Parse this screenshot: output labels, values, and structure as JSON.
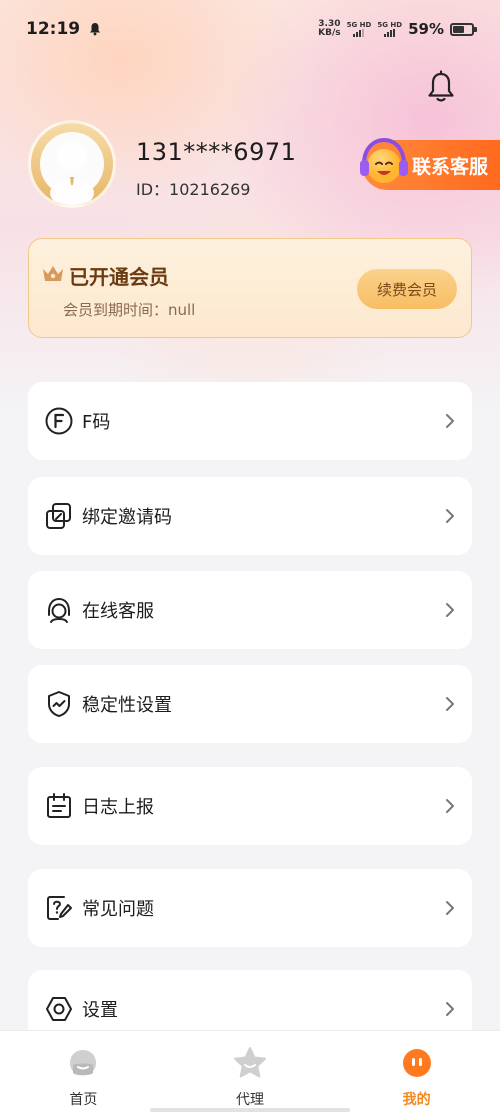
{
  "status_bar": {
    "time": "12:19",
    "speed_value": "3.30",
    "speed_unit": "KB/s",
    "sim1": "5G HD",
    "sim2": "5G HD",
    "battery_percent": "59%",
    "battery_level": 0.59
  },
  "profile": {
    "phone": "131****6971",
    "id_text": "ID：10216269",
    "contact_label": "联系客服"
  },
  "vip": {
    "title": "已开通会员",
    "expire_text": "会员到期时间：null",
    "renew_label": "续费会员"
  },
  "menu": {
    "items": [
      {
        "label": "F码",
        "icon": "f-code-icon"
      },
      {
        "label": "绑定邀请码",
        "icon": "copy-link-icon"
      },
      {
        "label": "在线客服",
        "icon": "headset-icon"
      },
      {
        "label": "稳定性设置",
        "icon": "shield-icon"
      },
      {
        "label": "日志上报",
        "icon": "calendar-log-icon"
      },
      {
        "label": "常见问题",
        "icon": "question-edit-icon"
      },
      {
        "label": "设置",
        "icon": "hexagon-settings-icon"
      }
    ]
  },
  "tabbar": {
    "tabs": [
      {
        "label": "首页",
        "icon": "home-icon",
        "active": false
      },
      {
        "label": "代理",
        "icon": "star-agent-icon",
        "active": false
      },
      {
        "label": "我的",
        "icon": "mine-icon",
        "active": true
      }
    ]
  },
  "colors": {
    "accent": "#f2891e",
    "contact_orange": "#ff6a1e",
    "vip_gold": "#f7bd64"
  }
}
